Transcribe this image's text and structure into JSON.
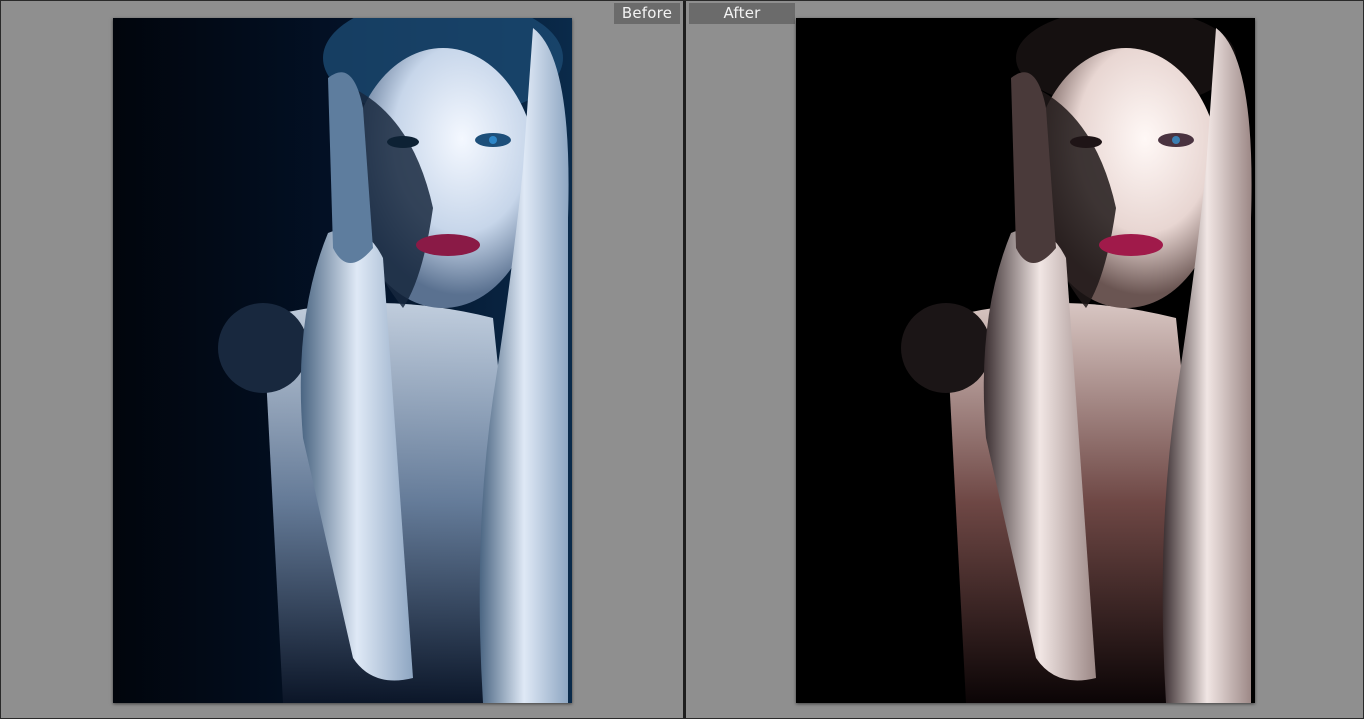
{
  "view": {
    "before_label": "Before",
    "after_label": "After"
  },
  "colors": {
    "background": "#8f8f8f",
    "divider": "#1e1e1e",
    "tab_background": "#6b6b6b",
    "tab_text": "#f3f3f3",
    "before_tint": "#0a1c36",
    "after_tint": "#000000"
  },
  "images": {
    "before": {
      "description_icon": "portrait-photo-before"
    },
    "after": {
      "description_icon": "portrait-photo-after"
    }
  }
}
